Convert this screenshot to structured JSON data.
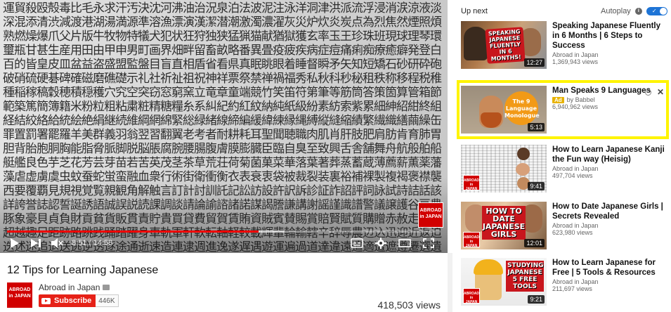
{
  "player": {
    "kanji": "運貿殺殴殻毒比毛永求汗汚決沈河沸油治況泉泊法波泥注泳洋洞津洪派流浮浸消涙涼液淡深混添清渋減渡港湖湯満源準溶漁漂演漢潔潜潮激濁濃濯灰災炉炊炎炭点為烈焦然煙照煩熟燃燥爆爪父片版牛牧物特犠犬犯状狂狩独狭猛猟猫献猶獄獲玄率玉王珍珠班現球理琴環璽瓶甘甚生産用田由甲申男町画界畑畔留畜畝略番異畳疫疲疾病症痘痛痢痴療癒癖発登白百的皆皇皮皿盆益盗盛盟監盤目盲直相盾省看県真眠眺眼着睡督瞬矛矢知短矯石砂研砕砲破硝硫硬碁碑確磁磨礁礎示礼社祈祉祖祝神祥票祭禁禅禍福秀私秋科秒秘租秩称移程税稚種稲稼稿穀穂積穏穫穴究空突窃窓窮窯立竜章童端競竹笑笛符第筆等筋筒答策箇算管箱節範築篤簡簿籍米粉粒粗粘粛粧精糖糧糸系糾紀約紅紋納純紙級紛素紡索紫累細紳紹紺終組経結絞絡給統絵絶絹継続維綱網綿緊総緑緒線締編緩緯練縁縄縛縦縫縮績繁繊織繕繭繰缶罪置罰署罷羅羊美群義羽翁翌習翻翼老考者耐耕耗耳聖聞聴職肉肌肖肝肢肥肩肪肯育肺胃胆背胎胞胴胸能脂脅脈脚脱脳脹腐腕腰腸腹膚膜膨臓臣臨自臭至致興舌舎舗舞舟航般舶船艇艦良色芋芝花芳芸芽苗若苦英茂茎茶草荒荘荷菊菌菓菜華落葉著葬蒸蓄蔵薄薦薪薫薬藩藻虐虚虜虞虫蚊蚕蛇蛍蛮融血衆行術街衛衝衡衣表衰衷袋被裁裂装裏裕補裸製複褐褒襟襲西要覆覇見規視覚覧親観角解触言訂計討訓託記訟訪設許訳訴診証詐詔評詞詠試詩詰話該詳誇誉誌認誓誕誘語誠誤説読課調談請論諭諮諸諾謀謁謄謙講謝謡謹識譜警議譲護谷豆豊豚象豪貝貞負財貢貧貨販貫責貯貴買貸費貿賀賃賄資賊賓賛賜賞賠賢賦質購贈赤赦走赴起超越趣足距跡路跳践踊踏躍身車軌軍軒軟転軸軽較載輝輩輪輸轄辛辞辱農辺込迅迎近返迫迭述迷追退送逃逆透逐途通逝速造連逮週進逸遂遅遇遊運遍過道達違遠遣適遭遮遵遷選遺避還邦邪邸郊郎郡部郭郵郷都酌配酒酔酢酪酬酵酷酸醜醸釈里重野量金針釣鈍鈴鉄鉛鉢鉱銀銃銅銑銘銭鋭鋳鋼錘錠錬錯録鍛鎖鎮鏡鐘鑑長門閉開閑間関閣閥閲闘防阻附降限陛院陣除陥陪陰陳陵陶陸険陽隅隆隊階随隔際障隠隣隷隻雄雅集雇雌雑離難雨雪雰雲零雷電需震霊霜霧露青静非面革靴音韻響頂項順預頑頒領頭頻頼題額顔顕願類顧風飛食飢飯飲飼飽飾養餓館首香馬駄駅駆駐騎騒験騰驚骨髄高髪鬼魂魅魔魚鮮鯨鳥鳴鶏麗麦麻黄黒黙鼓鼻齢運貿殺殴殻毒比毛永求汗汚決沈河沸油治況泉泊法波泥注泳洋洞津洪派流浮浸消涙涼液淡深混添清渋減渡港湖湯満源準溶漁漂演漢潔潜潮激濁濃濯灰災炉炊炎炭点為烈焦然煙照煩熟燃燥爆爪父片版牛牧物特犠犬犯状狂狩独狭猛猟猫献猶獄獲玄率玉王珍珠班現球理琴環璽瓶甘甚生産用田由甲申男町画界畑畔留畜畝略番異畳疫疲疾病症痘痛痢痴療癒癖発登白百的皆皇皮皿盆益盗盛盟監盤目盲直相盾省看県真眠眺眼着睡督瞬矛矢知短矯石砂研砕砲破",
    "logo_text": "ABROAD in JAPAN",
    "progress_fraction": 0.58,
    "buffer_fraction": 0.06,
    "time_current": "8:51",
    "time_sep": "/",
    "time_total": "14:58"
  },
  "video": {
    "title": "12 Tips for Learning Japanese",
    "channel_name": "Abroad in Japan",
    "channel_logo_text": "ABROAD in JAPAN",
    "subscribe_label": "Subscribe",
    "subscriber_count": "446K",
    "views": "418,503 views"
  },
  "sidebar": {
    "up_next": "Up next",
    "autoplay_label": "Autoplay",
    "autoplay_on": true,
    "items": [
      {
        "title": "Speaking Japanese Fluently in 6 Months | 6 Steps to Success",
        "channel": "Abroad in Japan",
        "views": "1,369,943 views",
        "duration": "12:27",
        "thumb_text": "SPEAKING JAPANESE FLUENTLY IN 6 MONTHS!"
      },
      {
        "title": "Man Speaks 9 Languages",
        "ad_label": "Ad",
        "channel": "by Babbel",
        "views": "6,940,962 views",
        "duration": "5:13",
        "thumb_text": "The 9 Language Monologue"
      },
      {
        "title": "How to Learn Japanese Kanji the Fun way (Heisig)",
        "channel": "Abroad in Japan",
        "views": "497,704 views",
        "duration": "9:41",
        "thumb_text": ""
      },
      {
        "title": "How to Date Japanese Girls | Secrets Revealed",
        "channel": "Abroad in Japan",
        "views": "623,980 views",
        "duration": "12:01",
        "thumb_text": "HOW TO DATE JAPANESE GIRLS"
      },
      {
        "title": "How to Learn Japanese for Free | 5 Tools & Resources",
        "channel": "Abroad in Japan",
        "views": "211,697 views",
        "duration": "9:21",
        "thumb_text": "STUDYING JAPANESE 5 FREE TOOLS"
      }
    ]
  },
  "colors": {
    "accent_red": "#e62117",
    "highlight_yellow": "#fff400",
    "toggle_blue": "#1e74d6"
  },
  "icons": [
    "play-icon",
    "next-icon",
    "mute-icon",
    "subtitles-icon",
    "settings-icon",
    "theater-icon",
    "fullscreen-icon",
    "info-icon",
    "close-icon"
  ]
}
